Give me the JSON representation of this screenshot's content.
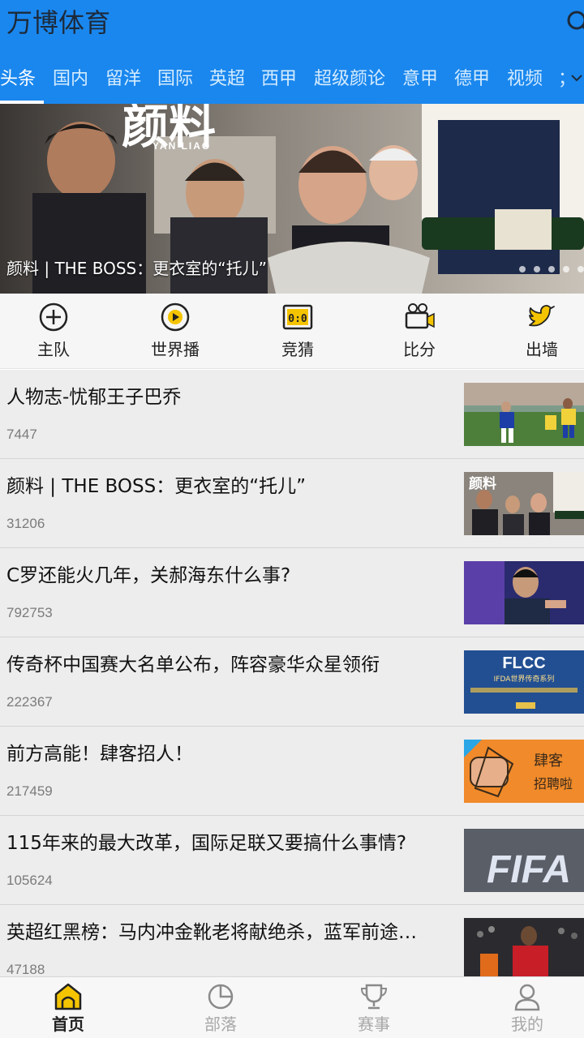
{
  "app": {
    "title": "万博体育"
  },
  "tabs": [
    {
      "label": "头条",
      "active": true
    },
    {
      "label": "国内"
    },
    {
      "label": "留洋"
    },
    {
      "label": "国际"
    },
    {
      "label": "英超"
    },
    {
      "label": "西甲"
    },
    {
      "label": "超级颜论"
    },
    {
      "label": "意甲"
    },
    {
      "label": "德甲"
    },
    {
      "label": "视频"
    },
    {
      "label": "；"
    }
  ],
  "banner": {
    "caption": "颜料 | THE BOSS：更衣室的“托儿”",
    "logo_text": "颜料",
    "logo_subtext": "YAN  LIAO",
    "slide_count": 5,
    "active_slide": 1
  },
  "quick_actions": [
    {
      "label": "主队",
      "icon": "plus-circle-icon"
    },
    {
      "label": "世界播",
      "icon": "play-ball-icon"
    },
    {
      "label": "竞猜",
      "icon": "scoreboard-icon"
    },
    {
      "label": "比分",
      "icon": "video-camera-icon"
    },
    {
      "label": "出墙",
      "icon": "twitter-bird-icon"
    }
  ],
  "articles": [
    {
      "title": "人物志-忧郁王子巴乔",
      "count": "7447",
      "thumb": "football-match"
    },
    {
      "title": "颜料 | THE BOSS：更衣室的“托儿”",
      "count": "31206",
      "thumb": "yanliao-celebration",
      "thumb_text": "颜料"
    },
    {
      "title": "C罗还能火几年，关郝海东什么事?",
      "count": "792753",
      "thumb": "speaker-portrait"
    },
    {
      "title": "传奇杯中国赛大名单公布，阵容豪华众星领衔",
      "count": "222367",
      "thumb": "flcc-banner",
      "thumb_text": "FLCC",
      "thumb_subtext": "IFDA世界传奇系列"
    },
    {
      "title": "前方高能！肆客招人！",
      "count": "217459",
      "thumb": "recruit-poster",
      "thumb_text": "肆客",
      "thumb_subtext": "招聘啦"
    },
    {
      "title": "115年来的最大改革，国际足联又要搞什么事情?",
      "count": "105624",
      "thumb": "fifa-sign",
      "thumb_text": "FIFA"
    },
    {
      "title": "英超红黑榜：马内冲金靴老将献绝杀，蓝军前途…",
      "count": "47188",
      "thumb": "red-player"
    }
  ],
  "bottom_nav": [
    {
      "label": "首页",
      "icon": "home-icon",
      "active": true
    },
    {
      "label": "部落",
      "icon": "pie-chart-icon"
    },
    {
      "label": "赛事",
      "icon": "trophy-icon"
    },
    {
      "label": "我的",
      "icon": "user-icon"
    }
  ],
  "colors": {
    "primary": "#1a87ee",
    "accent": "#f5c400",
    "text": "#111111",
    "muted": "#7b7b7b"
  }
}
